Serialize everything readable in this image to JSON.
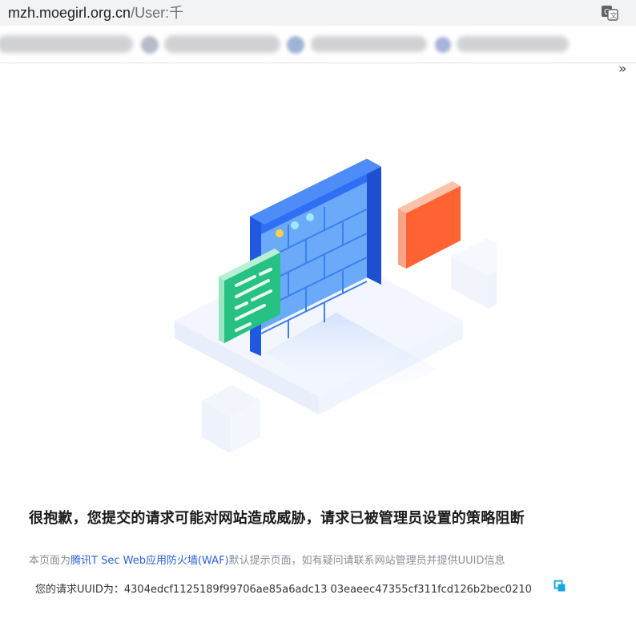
{
  "browser": {
    "url_host": "mzh.moegirl.org.cn",
    "url_path": "/User:千",
    "overflow": "»"
  },
  "block_page": {
    "headline": "很抱歉，您提交的请求可能对网站造成威胁，请求已被管理员设置的策略阻断",
    "note_prefix": "本页面为",
    "note_link": "腾讯T Sec Web应用防火墙(WAF)",
    "note_suffix": "默认提示页面，如有疑问请联系网站管理员并提供UUID信息",
    "uuid_label": "您的请求UUID为：",
    "uuid_value": "4304edcf1125189f99706ae85a6adc13 03eaeec47355cf311fcd126b2bec0210"
  },
  "icons": {
    "translate": "translate-icon",
    "copy": "copy-icon",
    "illustration": "firewall-illustration"
  },
  "colors": {
    "wall_blue": "#2f6ff3",
    "brick_blue": "#5fa5f9",
    "green_panel": "#27c283",
    "orange_block": "#ff6233",
    "link": "#2a62d6",
    "copy_icon": "#17a7e0"
  }
}
